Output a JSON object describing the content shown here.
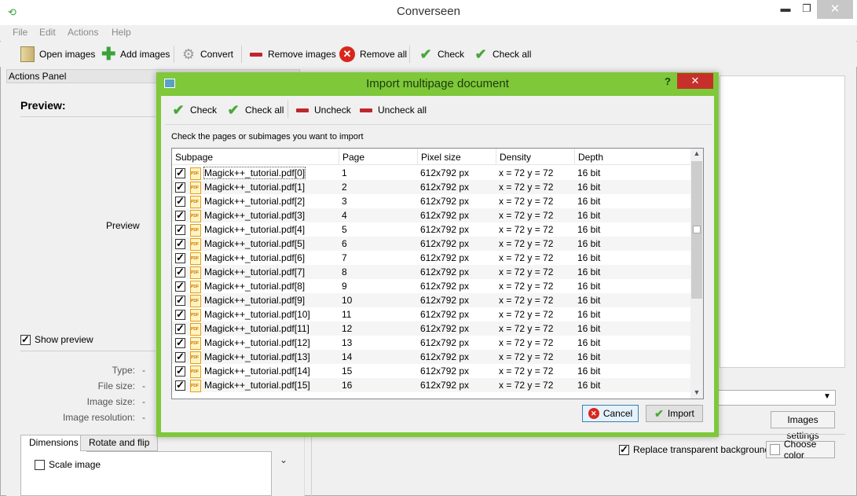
{
  "window": {
    "title": "Converseen",
    "minimize_label": "▬",
    "maximize_label": "❐",
    "close_label": "✕"
  },
  "menu": [
    "File",
    "Edit",
    "Actions",
    "Help"
  ],
  "toolbar": {
    "open_images": "Open images",
    "add_images": "Add images",
    "convert": "Convert",
    "remove_images": "Remove images",
    "remove_all": "Remove all",
    "check": "Check",
    "check_all": "Check all"
  },
  "actions_panel": {
    "header": "Actions Panel",
    "preview_title": "Preview:",
    "preview_placeholder": "Preview",
    "show_preview": "Show preview",
    "info": [
      {
        "label": "Type:",
        "value": "-"
      },
      {
        "label": "File size:",
        "value": "-"
      },
      {
        "label": "Image size:",
        "value": "-"
      },
      {
        "label": "Image resolution:",
        "value": "-"
      }
    ],
    "tabs": [
      "Dimensions",
      "Rotate and flip"
    ],
    "scale_image": "Scale image"
  },
  "right": {
    "images_settings": "Images settings",
    "replace_transparent": "Replace transparent background",
    "choose_color": "Choose color"
  },
  "dialog": {
    "title": "Import multipage document",
    "help": "?",
    "close": "✕",
    "toolbar": {
      "check": "Check",
      "check_all": "Check all",
      "uncheck": "Uncheck",
      "uncheck_all": "Uncheck all"
    },
    "instructions": "Check the pages or subimages you want to import",
    "columns": [
      "Subpage",
      "Page",
      "Pixel size",
      "Density",
      "Depth"
    ],
    "rows": [
      {
        "name": "Magick++_tutorial.pdf[0]",
        "page": "1",
        "pixel": "612x792 px",
        "density": "x = 72 y = 72",
        "depth": "16 bit"
      },
      {
        "name": "Magick++_tutorial.pdf[1]",
        "page": "2",
        "pixel": "612x792 px",
        "density": "x = 72 y = 72",
        "depth": "16 bit"
      },
      {
        "name": "Magick++_tutorial.pdf[2]",
        "page": "3",
        "pixel": "612x792 px",
        "density": "x = 72 y = 72",
        "depth": "16 bit"
      },
      {
        "name": "Magick++_tutorial.pdf[3]",
        "page": "4",
        "pixel": "612x792 px",
        "density": "x = 72 y = 72",
        "depth": "16 bit"
      },
      {
        "name": "Magick++_tutorial.pdf[4]",
        "page": "5",
        "pixel": "612x792 px",
        "density": "x = 72 y = 72",
        "depth": "16 bit"
      },
      {
        "name": "Magick++_tutorial.pdf[5]",
        "page": "6",
        "pixel": "612x792 px",
        "density": "x = 72 y = 72",
        "depth": "16 bit"
      },
      {
        "name": "Magick++_tutorial.pdf[6]",
        "page": "7",
        "pixel": "612x792 px",
        "density": "x = 72 y = 72",
        "depth": "16 bit"
      },
      {
        "name": "Magick++_tutorial.pdf[7]",
        "page": "8",
        "pixel": "612x792 px",
        "density": "x = 72 y = 72",
        "depth": "16 bit"
      },
      {
        "name": "Magick++_tutorial.pdf[8]",
        "page": "9",
        "pixel": "612x792 px",
        "density": "x = 72 y = 72",
        "depth": "16 bit"
      },
      {
        "name": "Magick++_tutorial.pdf[9]",
        "page": "10",
        "pixel": "612x792 px",
        "density": "x = 72 y = 72",
        "depth": "16 bit"
      },
      {
        "name": "Magick++_tutorial.pdf[10]",
        "page": "11",
        "pixel": "612x792 px",
        "density": "x = 72 y = 72",
        "depth": "16 bit"
      },
      {
        "name": "Magick++_tutorial.pdf[11]",
        "page": "12",
        "pixel": "612x792 px",
        "density": "x = 72 y = 72",
        "depth": "16 bit"
      },
      {
        "name": "Magick++_tutorial.pdf[12]",
        "page": "13",
        "pixel": "612x792 px",
        "density": "x = 72 y = 72",
        "depth": "16 bit"
      },
      {
        "name": "Magick++_tutorial.pdf[13]",
        "page": "14",
        "pixel": "612x792 px",
        "density": "x = 72 y = 72",
        "depth": "16 bit"
      },
      {
        "name": "Magick++_tutorial.pdf[14]",
        "page": "15",
        "pixel": "612x792 px",
        "density": "x = 72 y = 72",
        "depth": "16 bit"
      },
      {
        "name": "Magick++_tutorial.pdf[15]",
        "page": "16",
        "pixel": "612x792 px",
        "density": "x = 72 y = 72",
        "depth": "16 bit"
      }
    ],
    "cancel": "Cancel",
    "import": "Import"
  },
  "colors": {
    "dialog_accent": "#7ec839",
    "close_red": "#c7302a"
  }
}
